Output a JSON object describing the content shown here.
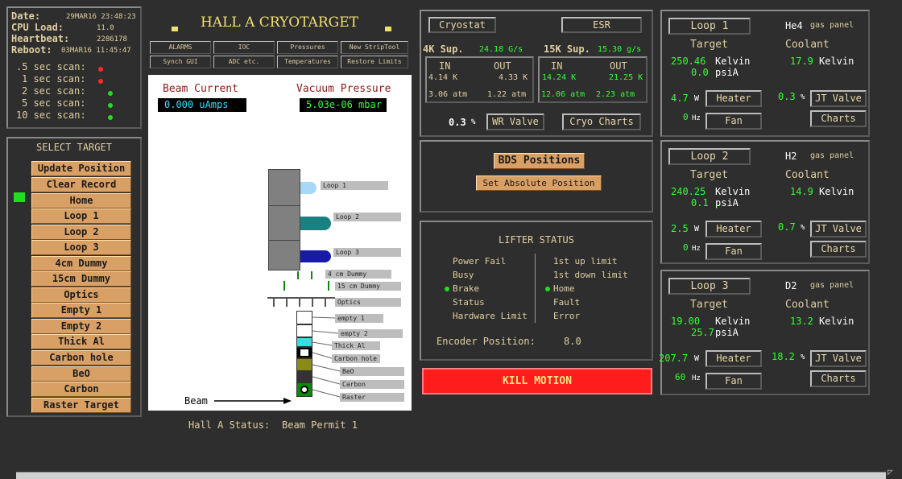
{
  "status_panel": {
    "date_label": "Date:",
    "date_value": "29MAR16 23:48:23",
    "cpu_label": "CPU Load:",
    "cpu_value": "11.0",
    "heartbeat_label": "Heartbeat:",
    "heartbeat_value": "2286178",
    "reboot_label": "Reboot:",
    "reboot_value": "03MAR16 11:45:47",
    "scans": [
      {
        "label": ".5 sec scan:",
        "state": "red"
      },
      {
        "label": "1 sec scan:",
        "state": "red"
      },
      {
        "label": "2 sec scan:",
        "state": "green"
      },
      {
        "label": "5 sec scan:",
        "state": "green"
      },
      {
        "label": "10 sec scan:",
        "state": "green"
      }
    ]
  },
  "select_target": {
    "title": "SELECT TARGET",
    "buttons": [
      "Update Position",
      "Clear Record",
      "Home",
      "Loop 1",
      "Loop 2",
      "Loop 3",
      "4cm Dummy",
      "15cm Dummy",
      "Optics",
      "Empty 1",
      "Empty 2",
      "Thick Al",
      "Carbon hole",
      "BeO",
      "Carbon",
      "Raster Target"
    ],
    "active_indicator": "Home"
  },
  "header": {
    "title": "HALL A CRYOTARGET",
    "nav_row1": [
      "ALARMS",
      "IOC",
      "Pressures",
      "New StripTool"
    ],
    "nav_row2": [
      "Synch GUI",
      "ADC etc.",
      "Temperatures",
      "Restore Limits"
    ]
  },
  "beam": {
    "current_label": "Beam Current",
    "current_value": "0.000 uAmps",
    "vacuum_label": "Vacuum Pressure",
    "vacuum_value": "5.03e-06 mbar",
    "beam_label": "Beam",
    "target_labels": [
      "Loop 1",
      "Loop 2",
      "Loop 3",
      "4 cm Dummy",
      "15 cm Dummy",
      "Optics",
      "empty 1",
      "empty 2",
      "Thick Al",
      "Carbon hole",
      "BeO",
      "Carbon",
      "Raster"
    ]
  },
  "hall_status": {
    "label": "Hall A Status:",
    "value": "Beam Permit 1"
  },
  "cryostat": {
    "cryostat_btn": "Cryostat",
    "esr_btn": "ESR",
    "sup4k_label": "4K Sup.",
    "sup4k_value": "24.18 G/s",
    "sup15k_label": "15K Sup.",
    "sup15k_value": "15.30 g/s",
    "in_label": "IN",
    "out_label": "OUT",
    "k4_in_temp": "4.14 K",
    "k4_out_temp": "4.33 K",
    "k4_in_press": "3.06 atm",
    "k4_out_press": "1.22 atm",
    "k15_in_temp": "14.24 K",
    "k15_out_temp": "21.25 K",
    "k15_in_press": "12.06 atm",
    "k15_out_press": "2.23 atm",
    "wr_value": "0.3",
    "pct": "%",
    "wr_btn": "WR Valve",
    "charts_btn": "Cryo Charts"
  },
  "bds": {
    "positions_btn": "BDS Positions",
    "set_abs_btn": "Set Absolute Position"
  },
  "lifter": {
    "title": "LIFTER STATUS",
    "left": [
      "Power Fail",
      "Busy",
      "Brake",
      "Status",
      "Hardware Limit"
    ],
    "right": [
      "1st up limit",
      "1st down limit",
      "Home",
      "Fault",
      "Error"
    ],
    "left_active": "Brake",
    "right_active": "Home",
    "encoder_label": "Encoder Position:",
    "encoder_value": "8.0"
  },
  "kill_motion": "KILL MOTION",
  "loops": [
    {
      "btn": "Loop 1",
      "gas": "He4",
      "gas_suffix": "gas panel",
      "target_label": "Target",
      "coolant_label": "Coolant",
      "target_temp": "250.46",
      "unit_k": "Kelvin",
      "target_press": "0.0",
      "unit_p": "psiA",
      "coolant_temp": "17.9",
      "heater_value": "4.7",
      "unit_w": "W",
      "heater_btn": "Heater",
      "jt_value": "0.3",
      "jt_btn": "JT Valve",
      "fan_value": "0",
      "unit_hz": "Hz",
      "fan_btn": "Fan",
      "charts_btn": "Charts"
    },
    {
      "btn": "Loop 2",
      "gas": "H2",
      "gas_suffix": "gas panel",
      "target_label": "Target",
      "coolant_label": "Coolant",
      "target_temp": "240.25",
      "unit_k": "Kelvin",
      "target_press": "0.1",
      "unit_p": "psiA",
      "coolant_temp": "14.9",
      "heater_value": "2.5",
      "unit_w": "W",
      "heater_btn": "Heater",
      "jt_value": "0.7",
      "jt_btn": "JT Valve",
      "fan_value": "0",
      "unit_hz": "Hz",
      "fan_btn": "Fan",
      "charts_btn": "Charts"
    },
    {
      "btn": "Loop 3",
      "gas": "D2",
      "gas_suffix": "gas panel",
      "target_label": "Target",
      "coolant_label": "Coolant",
      "target_temp": "19.00",
      "unit_k": "Kelvin",
      "target_press": "25.7",
      "unit_p": "psiA",
      "coolant_temp": "13.2",
      "heater_value": "207.7",
      "unit_w": "W",
      "heater_btn": "Heater",
      "jt_value": "18.2",
      "jt_btn": "JT Valve",
      "fan_value": "60",
      "unit_hz": "Hz",
      "fan_btn": "Fan",
      "charts_btn": "Charts"
    }
  ],
  "colors": {
    "background": "#2e2e2e",
    "target_button": "#d9a066",
    "value_green": "#33ff33",
    "kill": "#ff1c1c"
  }
}
